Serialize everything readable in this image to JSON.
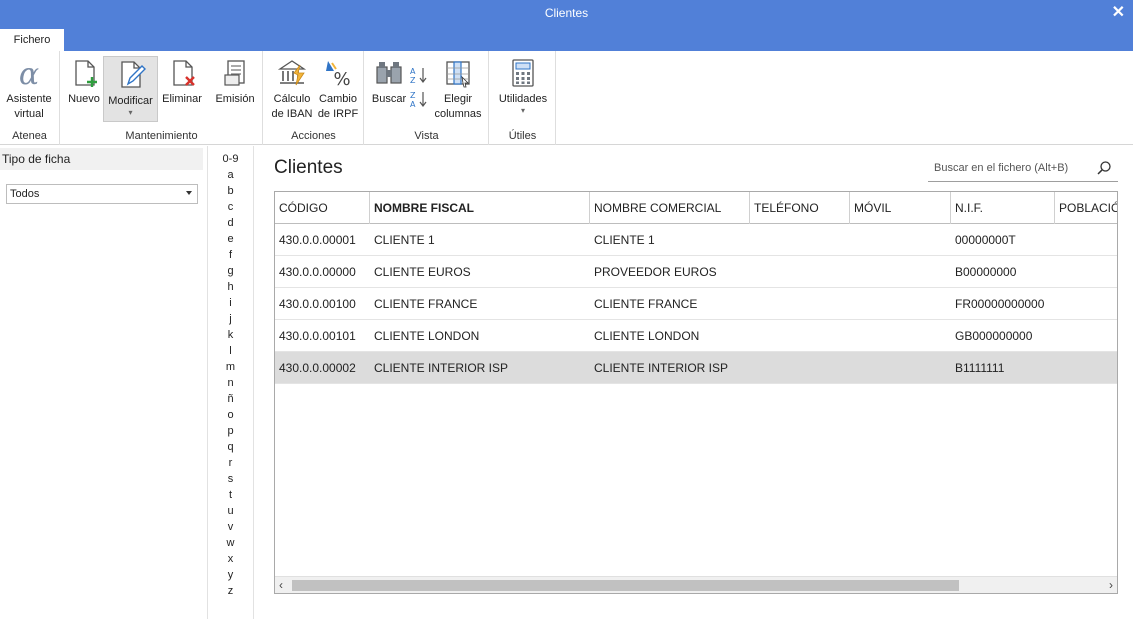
{
  "window": {
    "title": "Clientes",
    "close_glyph": "✕"
  },
  "tabs": {
    "file": "Fichero"
  },
  "ribbon": {
    "groups": {
      "atenea": "Atenea",
      "mantenimiento": "Mantenimiento",
      "acciones": "Acciones",
      "vista": "Vista",
      "utiles": "Útiles"
    },
    "buttons": {
      "asistente_1": "Asistente",
      "asistente_2": "virtual",
      "nuevo": "Nuevo",
      "modificar": "Modificar",
      "eliminar": "Eliminar",
      "emision": "Emisión",
      "iban_1": "Cálculo",
      "iban_2": "de IBAN",
      "irpf_1": "Cambio",
      "irpf_2": "de IRPF",
      "buscar": "Buscar",
      "columnas_1": "Elegir",
      "columnas_2": "columnas",
      "utilidades": "Utilidades"
    },
    "caret": "▾"
  },
  "left_panel": {
    "header": "Tipo de ficha",
    "filter_value": "Todos"
  },
  "alphabet": [
    "0-9",
    "a",
    "b",
    "c",
    "d",
    "e",
    "f",
    "g",
    "h",
    "i",
    "j",
    "k",
    "l",
    "m",
    "n",
    "ñ",
    "o",
    "p",
    "q",
    "r",
    "s",
    "t",
    "u",
    "v",
    "w",
    "x",
    "y",
    "z"
  ],
  "main": {
    "title": "Clientes",
    "search_placeholder": "Buscar en el fichero (Alt+B)"
  },
  "table": {
    "columns": [
      "CÓDIGO",
      "NOMBRE FISCAL",
      "NOMBRE COMERCIAL",
      "TELÉFONO",
      "MÓVIL",
      "N.I.F.",
      "POBLACIÓ"
    ],
    "rows": [
      [
        "430.0.0.00001",
        "CLIENTE 1",
        "CLIENTE 1",
        "",
        "",
        "00000000T",
        ""
      ],
      [
        "430.0.0.00000",
        "CLIENTE EUROS",
        "PROVEEDOR EUROS",
        "",
        "",
        "B00000000",
        ""
      ],
      [
        "430.0.0.00100",
        "CLIENTE FRANCE",
        "CLIENTE FRANCE",
        "",
        "",
        "FR00000000000",
        ""
      ],
      [
        "430.0.0.00101",
        "CLIENTE LONDON",
        "CLIENTE LONDON",
        "",
        "",
        "GB000000000",
        ""
      ],
      [
        "430.0.0.00002",
        "CLIENTE INTERIOR ISP",
        "CLIENTE INTERIOR ISP",
        "",
        "",
        "B1111111",
        ""
      ]
    ],
    "selected_row": 4
  },
  "scrollbar": {
    "left_arrow": "‹",
    "right_arrow": "›"
  },
  "colors": {
    "titlebar": "#5180d8",
    "selected_row": "#dcdcdc"
  }
}
